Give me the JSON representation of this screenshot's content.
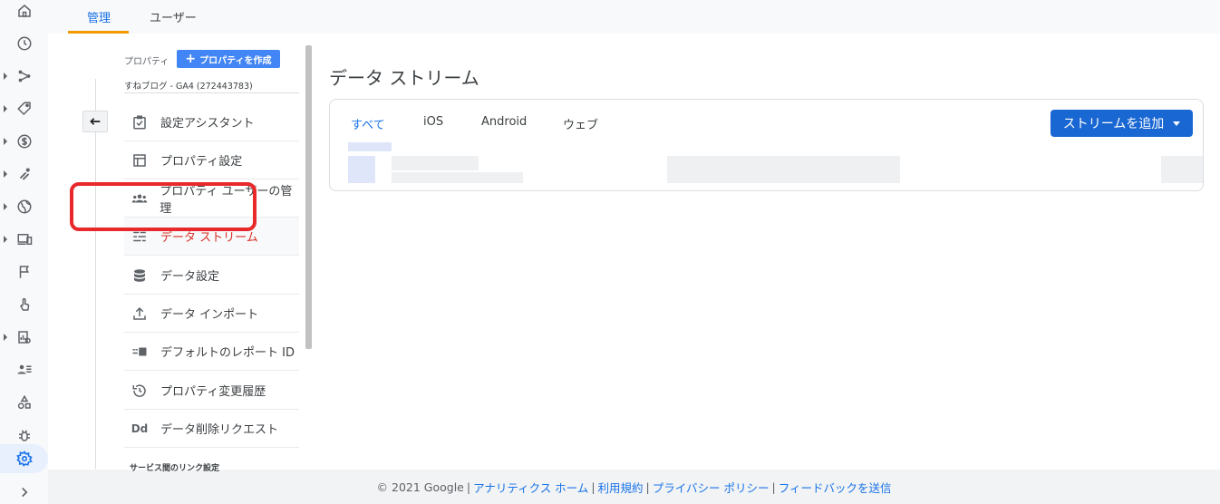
{
  "top_tabs": [
    {
      "label": "管理",
      "active": true
    },
    {
      "label": "ユーザー",
      "active": false
    }
  ],
  "rail_icons": [
    {
      "name": "home-icon",
      "caret": false
    },
    {
      "name": "clock-icon",
      "caret": false
    },
    {
      "name": "share-icon",
      "caret": true
    },
    {
      "name": "tag-icon",
      "caret": true
    },
    {
      "name": "dollar-icon",
      "caret": true
    },
    {
      "name": "magnet-icon",
      "caret": true
    },
    {
      "name": "globe-icon",
      "caret": true
    },
    {
      "name": "devices-icon",
      "caret": true
    },
    {
      "name": "flag-icon",
      "caret": false
    },
    {
      "name": "touch-icon",
      "caret": false
    },
    {
      "name": "report-icon",
      "caret": true
    },
    {
      "name": "audience-icon",
      "caret": false
    },
    {
      "name": "shapes-icon",
      "caret": false
    },
    {
      "name": "bug-icon",
      "caret": false
    },
    {
      "name": "settings-icon",
      "caret": false,
      "active": true
    },
    {
      "name": "expand-icon",
      "caret": false
    }
  ],
  "property": {
    "label": "プロパティ",
    "create_button": "プロパティを作成",
    "name": "すねブログ - GA4 (272443783)"
  },
  "menu_items": [
    {
      "label": "設定アシスタント",
      "icon": "checklist-icon"
    },
    {
      "label": "プロパティ設定",
      "icon": "layout-icon"
    },
    {
      "label": "プロパティ ユーザーの管理",
      "icon": "people-icon"
    },
    {
      "label": "データ ストリーム",
      "icon": "streams-icon",
      "active": true
    },
    {
      "label": "データ設定",
      "icon": "database-icon"
    },
    {
      "label": "データ インポート",
      "icon": "upload-icon"
    },
    {
      "label": "デフォルトのレポート ID",
      "icon": "id-icon"
    },
    {
      "label": "プロパティ変更履歴",
      "icon": "history-icon"
    },
    {
      "label": "データ削除リクエスト",
      "icon": "dd-icon"
    }
  ],
  "section_label": "サービス間のリンク設定",
  "main": {
    "title": "データ ストリーム",
    "tabs": [
      {
        "label": "すべて",
        "active": true
      },
      {
        "label": "iOS"
      },
      {
        "label": "Android"
      },
      {
        "label": "ウェブ"
      }
    ],
    "add_button": "ストリームを追加"
  },
  "footer": {
    "copyright": "© 2021 Google",
    "links": [
      "アナリティクス ホーム",
      "利用規約",
      "プライバシー ポリシー",
      "フィードバックを送信"
    ],
    "separator": "|"
  },
  "colors": {
    "accent": "#1a73e8",
    "active_menu": "#d93025",
    "highlight": "#e8282b",
    "tab_underline": "#f29900"
  }
}
